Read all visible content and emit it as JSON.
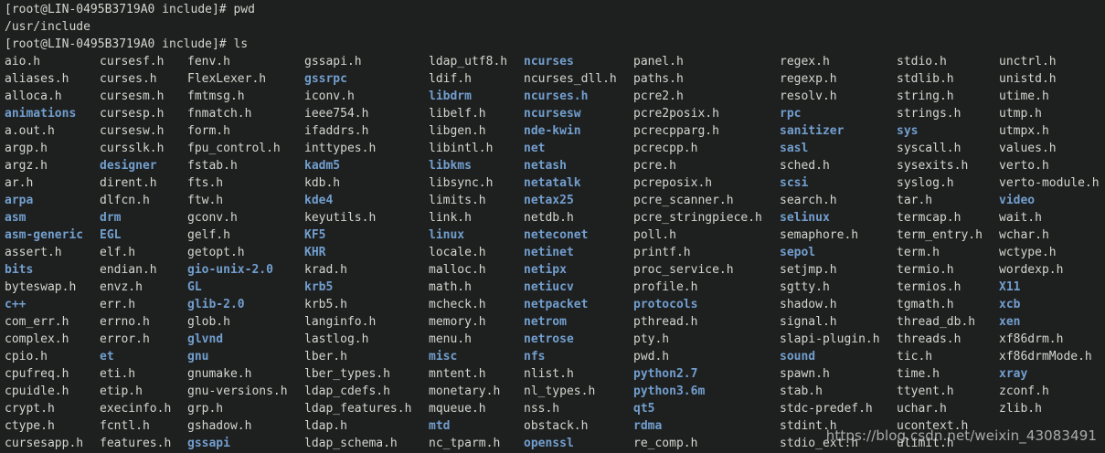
{
  "terminal": {
    "prompt": "[root@LIN-0495B3719A0 include]#",
    "commands": [
      "pwd",
      "ls"
    ],
    "pwd_output": "/usr/include",
    "listing": [
      [
        {
          "t": "aio.h"
        },
        {
          "t": "aliases.h"
        },
        {
          "t": "alloca.h"
        },
        {
          "t": "animations",
          "d": 1
        },
        {
          "t": "a.out.h"
        },
        {
          "t": "argp.h"
        },
        {
          "t": "argz.h"
        },
        {
          "t": "ar.h"
        },
        {
          "t": "arpa",
          "d": 1
        },
        {
          "t": "asm",
          "d": 1
        },
        {
          "t": "asm-generic",
          "d": 1
        },
        {
          "t": "assert.h"
        },
        {
          "t": "bits",
          "d": 1
        },
        {
          "t": "byteswap.h"
        },
        {
          "t": "c++",
          "d": 1
        },
        {
          "t": "com_err.h"
        },
        {
          "t": "complex.h"
        },
        {
          "t": "cpio.h"
        },
        {
          "t": "cpufreq.h"
        },
        {
          "t": "cpuidle.h"
        },
        {
          "t": "crypt.h"
        },
        {
          "t": "ctype.h"
        },
        {
          "t": "cursesapp.h"
        }
      ],
      [
        {
          "t": "cursesf.h"
        },
        {
          "t": "curses.h"
        },
        {
          "t": "cursesm.h"
        },
        {
          "t": "cursesp.h"
        },
        {
          "t": "cursesw.h"
        },
        {
          "t": "cursslk.h"
        },
        {
          "t": "designer",
          "d": 1
        },
        {
          "t": "dirent.h"
        },
        {
          "t": "dlfcn.h"
        },
        {
          "t": "drm",
          "d": 1
        },
        {
          "t": "EGL",
          "d": 1
        },
        {
          "t": "elf.h"
        },
        {
          "t": "endian.h"
        },
        {
          "t": "envz.h"
        },
        {
          "t": "err.h"
        },
        {
          "t": "errno.h"
        },
        {
          "t": "error.h"
        },
        {
          "t": "et",
          "d": 1
        },
        {
          "t": "eti.h"
        },
        {
          "t": "etip.h"
        },
        {
          "t": "execinfo.h"
        },
        {
          "t": "fcntl.h"
        },
        {
          "t": "features.h"
        }
      ],
      [
        {
          "t": "fenv.h"
        },
        {
          "t": "FlexLexer.h"
        },
        {
          "t": "fmtmsg.h"
        },
        {
          "t": "fnmatch.h"
        },
        {
          "t": "form.h"
        },
        {
          "t": "fpu_control.h"
        },
        {
          "t": "fstab.h"
        },
        {
          "t": "fts.h"
        },
        {
          "t": "ftw.h"
        },
        {
          "t": "gconv.h"
        },
        {
          "t": "gelf.h"
        },
        {
          "t": "getopt.h"
        },
        {
          "t": "gio-unix-2.0",
          "d": 1
        },
        {
          "t": "GL",
          "d": 1
        },
        {
          "t": "glib-2.0",
          "d": 1
        },
        {
          "t": "glob.h"
        },
        {
          "t": "glvnd",
          "d": 1
        },
        {
          "t": "gnu",
          "d": 1
        },
        {
          "t": "gnumake.h"
        },
        {
          "t": "gnu-versions.h"
        },
        {
          "t": "grp.h"
        },
        {
          "t": "gshadow.h"
        },
        {
          "t": "gssapi",
          "d": 1
        }
      ],
      [
        {
          "t": "gssapi.h"
        },
        {
          "t": "gssrpc",
          "d": 1
        },
        {
          "t": "iconv.h"
        },
        {
          "t": "ieee754.h"
        },
        {
          "t": "ifaddrs.h"
        },
        {
          "t": "inttypes.h"
        },
        {
          "t": "kadm5",
          "d": 1
        },
        {
          "t": "kdb.h"
        },
        {
          "t": "kde4",
          "d": 1
        },
        {
          "t": "keyutils.h"
        },
        {
          "t": "KF5",
          "d": 1
        },
        {
          "t": "KHR",
          "d": 1
        },
        {
          "t": "krad.h"
        },
        {
          "t": "krb5",
          "d": 1
        },
        {
          "t": "krb5.h"
        },
        {
          "t": "langinfo.h"
        },
        {
          "t": "lastlog.h"
        },
        {
          "t": "lber.h"
        },
        {
          "t": "lber_types.h"
        },
        {
          "t": "ldap_cdefs.h"
        },
        {
          "t": "ldap_features.h"
        },
        {
          "t": "ldap.h"
        },
        {
          "t": "ldap_schema.h"
        }
      ],
      [
        {
          "t": "ldap_utf8.h"
        },
        {
          "t": "ldif.h"
        },
        {
          "t": "libdrm",
          "d": 1
        },
        {
          "t": "libelf.h"
        },
        {
          "t": "libgen.h"
        },
        {
          "t": "libintl.h"
        },
        {
          "t": "libkms",
          "d": 1
        },
        {
          "t": "libsync.h"
        },
        {
          "t": "limits.h"
        },
        {
          "t": "link.h"
        },
        {
          "t": "linux",
          "d": 1
        },
        {
          "t": "locale.h"
        },
        {
          "t": "malloc.h"
        },
        {
          "t": "math.h"
        },
        {
          "t": "mcheck.h"
        },
        {
          "t": "memory.h"
        },
        {
          "t": "menu.h"
        },
        {
          "t": "misc",
          "d": 1
        },
        {
          "t": "mntent.h"
        },
        {
          "t": "monetary.h"
        },
        {
          "t": "mqueue.h"
        },
        {
          "t": "mtd",
          "d": 1
        },
        {
          "t": "nc_tparm.h"
        }
      ],
      [
        {
          "t": "ncurses",
          "d": 1
        },
        {
          "t": "ncurses_dll.h"
        },
        {
          "t": "ncurses.h",
          "d": 2
        },
        {
          "t": "ncursesw",
          "d": 1
        },
        {
          "t": "nde-kwin",
          "d": 1
        },
        {
          "t": "net",
          "d": 1
        },
        {
          "t": "netash",
          "d": 1
        },
        {
          "t": "netatalk",
          "d": 1
        },
        {
          "t": "netax25",
          "d": 1
        },
        {
          "t": "netdb.h"
        },
        {
          "t": "neteconet",
          "d": 1
        },
        {
          "t": "netinet",
          "d": 1
        },
        {
          "t": "netipx",
          "d": 1
        },
        {
          "t": "netiucv",
          "d": 1
        },
        {
          "t": "netpacket",
          "d": 1
        },
        {
          "t": "netrom",
          "d": 1
        },
        {
          "t": "netrose",
          "d": 1
        },
        {
          "t": "nfs",
          "d": 1
        },
        {
          "t": "nlist.h"
        },
        {
          "t": "nl_types.h"
        },
        {
          "t": "nss.h"
        },
        {
          "t": "obstack.h"
        },
        {
          "t": "openssl",
          "d": 1
        }
      ],
      [
        {
          "t": "panel.h"
        },
        {
          "t": "paths.h"
        },
        {
          "t": "pcre2.h"
        },
        {
          "t": "pcre2posix.h"
        },
        {
          "t": "pcrecpparg.h"
        },
        {
          "t": "pcrecpp.h"
        },
        {
          "t": "pcre.h"
        },
        {
          "t": "pcreposix.h"
        },
        {
          "t": "pcre_scanner.h"
        },
        {
          "t": "pcre_stringpiece.h"
        },
        {
          "t": "poll.h"
        },
        {
          "t": "printf.h"
        },
        {
          "t": "proc_service.h"
        },
        {
          "t": "profile.h"
        },
        {
          "t": "protocols",
          "d": 1
        },
        {
          "t": "pthread.h"
        },
        {
          "t": "pty.h"
        },
        {
          "t": "pwd.h"
        },
        {
          "t": "python2.7",
          "d": 1
        },
        {
          "t": "python3.6m",
          "d": 1
        },
        {
          "t": "qt5",
          "d": 1
        },
        {
          "t": "rdma",
          "d": 1
        },
        {
          "t": "re_comp.h"
        }
      ],
      [
        {
          "t": "regex.h"
        },
        {
          "t": "regexp.h"
        },
        {
          "t": "resolv.h"
        },
        {
          "t": "rpc",
          "d": 1
        },
        {
          "t": "sanitizer",
          "d": 1
        },
        {
          "t": "sasl",
          "d": 1
        },
        {
          "t": "sched.h"
        },
        {
          "t": "scsi",
          "d": 1
        },
        {
          "t": "search.h"
        },
        {
          "t": "selinux",
          "d": 1
        },
        {
          "t": "semaphore.h"
        },
        {
          "t": "sepol",
          "d": 1
        },
        {
          "t": "setjmp.h"
        },
        {
          "t": "sgtty.h"
        },
        {
          "t": "shadow.h"
        },
        {
          "t": "signal.h"
        },
        {
          "t": "slapi-plugin.h"
        },
        {
          "t": "sound",
          "d": 1
        },
        {
          "t": "spawn.h"
        },
        {
          "t": "stab.h"
        },
        {
          "t": "stdc-predef.h"
        },
        {
          "t": "stdint.h"
        },
        {
          "t": "stdio_ext.h"
        }
      ],
      [
        {
          "t": "stdio.h"
        },
        {
          "t": "stdlib.h"
        },
        {
          "t": "string.h"
        },
        {
          "t": "strings.h"
        },
        {
          "t": "sys",
          "d": 1
        },
        {
          "t": "syscall.h"
        },
        {
          "t": "sysexits.h"
        },
        {
          "t": "syslog.h"
        },
        {
          "t": "tar.h"
        },
        {
          "t": "termcap.h"
        },
        {
          "t": "term_entry.h"
        },
        {
          "t": "term.h"
        },
        {
          "t": "termio.h"
        },
        {
          "t": "termios.h"
        },
        {
          "t": "tgmath.h"
        },
        {
          "t": "thread_db.h"
        },
        {
          "t": "threads.h"
        },
        {
          "t": "tic.h"
        },
        {
          "t": "time.h"
        },
        {
          "t": "ttyent.h"
        },
        {
          "t": "uchar.h"
        },
        {
          "t": "ucontext.h"
        },
        {
          "t": "ulimit.h"
        }
      ],
      [
        {
          "t": "unctrl.h"
        },
        {
          "t": "unistd.h"
        },
        {
          "t": "utime.h"
        },
        {
          "t": "utmp.h"
        },
        {
          "t": "utmpx.h"
        },
        {
          "t": "values.h"
        },
        {
          "t": "verto.h"
        },
        {
          "t": "verto-module.h"
        },
        {
          "t": "video",
          "d": 1
        },
        {
          "t": "wait.h"
        },
        {
          "t": "wchar.h"
        },
        {
          "t": "wctype.h"
        },
        {
          "t": "wordexp.h"
        },
        {
          "t": "X11",
          "d": 1
        },
        {
          "t": "xcb",
          "d": 1
        },
        {
          "t": "xen",
          "d": 1
        },
        {
          "t": "xf86drm.h"
        },
        {
          "t": "xf86drmMode.h"
        },
        {
          "t": "xray",
          "d": 1
        },
        {
          "t": "zconf.h"
        },
        {
          "t": "zlib.h"
        }
      ]
    ]
  },
  "watermark": "https://blog.csdn.net/weixin_43083491",
  "colors": {
    "background": "#1e1f1f",
    "text": "#d3d7cf",
    "directory": "#729fcf"
  }
}
